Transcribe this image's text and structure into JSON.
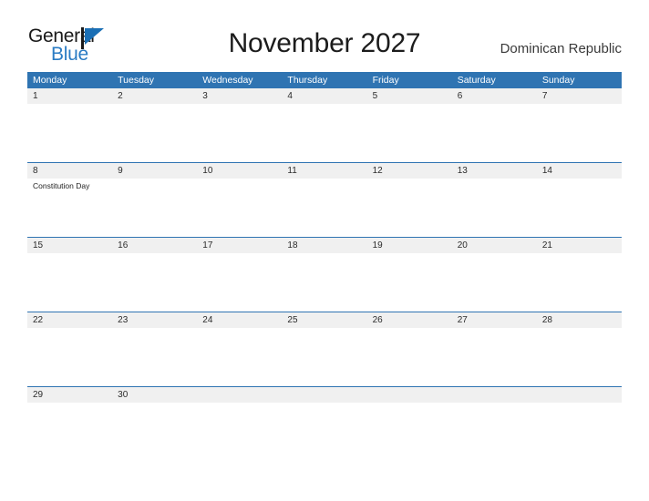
{
  "brand": {
    "name_part1": "General",
    "name_part2": "Blue",
    "flag_icon": "blue-flag-icon",
    "color_dark": "#1a1a1a",
    "color_blue": "#2b7cc4"
  },
  "header": {
    "title": "November 2027",
    "country": "Dominican Republic"
  },
  "theme": {
    "header_blue": "#2f74b2",
    "band_gray": "#f0f0f0",
    "separator_blue": "#2f74b2",
    "text_dark": "#222222",
    "text_white": "#ffffff"
  },
  "calendar": {
    "month": "November",
    "year": "2027",
    "weekdays": [
      "Monday",
      "Tuesday",
      "Wednesday",
      "Thursday",
      "Friday",
      "Saturday",
      "Sunday"
    ],
    "weeks": [
      {
        "days": [
          {
            "num": "1",
            "events": []
          },
          {
            "num": "2",
            "events": []
          },
          {
            "num": "3",
            "events": []
          },
          {
            "num": "4",
            "events": []
          },
          {
            "num": "5",
            "events": []
          },
          {
            "num": "6",
            "events": []
          },
          {
            "num": "7",
            "events": []
          }
        ]
      },
      {
        "days": [
          {
            "num": "8",
            "events": [
              "Constitution Day"
            ]
          },
          {
            "num": "9",
            "events": []
          },
          {
            "num": "10",
            "events": []
          },
          {
            "num": "11",
            "events": []
          },
          {
            "num": "12",
            "events": []
          },
          {
            "num": "13",
            "events": []
          },
          {
            "num": "14",
            "events": []
          }
        ]
      },
      {
        "days": [
          {
            "num": "15",
            "events": []
          },
          {
            "num": "16",
            "events": []
          },
          {
            "num": "17",
            "events": []
          },
          {
            "num": "18",
            "events": []
          },
          {
            "num": "19",
            "events": []
          },
          {
            "num": "20",
            "events": []
          },
          {
            "num": "21",
            "events": []
          }
        ]
      },
      {
        "days": [
          {
            "num": "22",
            "events": []
          },
          {
            "num": "23",
            "events": []
          },
          {
            "num": "24",
            "events": []
          },
          {
            "num": "25",
            "events": []
          },
          {
            "num": "26",
            "events": []
          },
          {
            "num": "27",
            "events": []
          },
          {
            "num": "28",
            "events": []
          }
        ]
      },
      {
        "days": [
          {
            "num": "29",
            "events": []
          },
          {
            "num": "30",
            "events": []
          },
          {
            "num": "",
            "events": []
          },
          {
            "num": "",
            "events": []
          },
          {
            "num": "",
            "events": []
          },
          {
            "num": "",
            "events": []
          },
          {
            "num": "",
            "events": []
          }
        ]
      }
    ]
  }
}
